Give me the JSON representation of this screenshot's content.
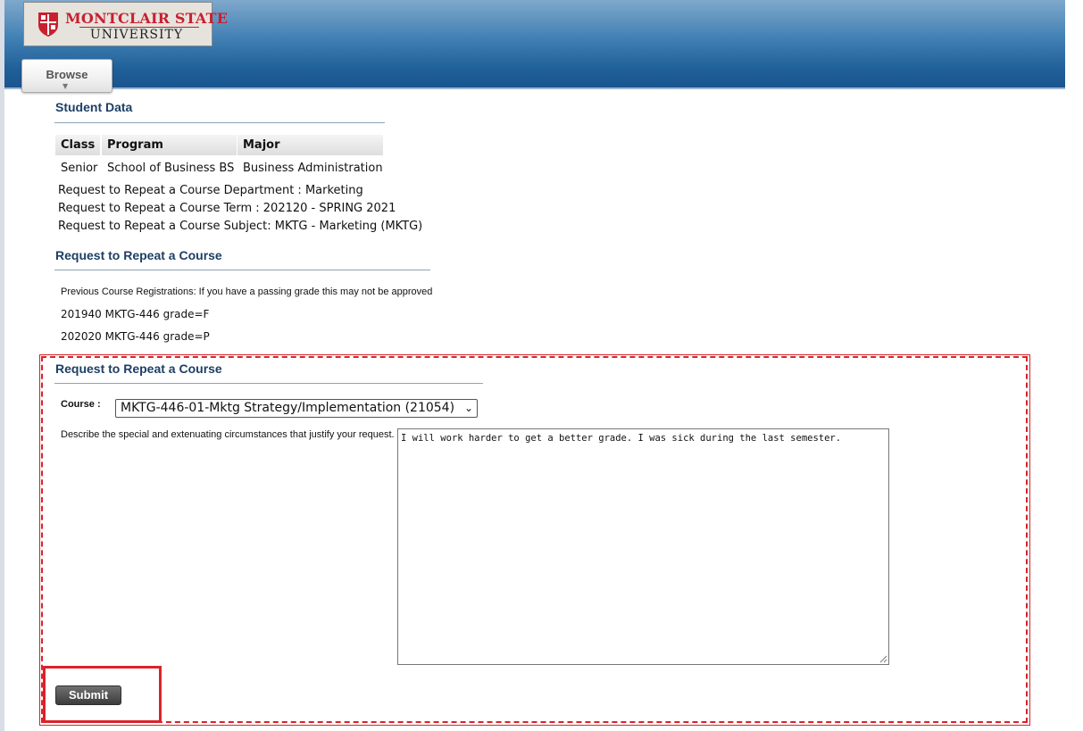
{
  "header": {
    "logo_line1": "MONTCLAIR STATE",
    "logo_line2": "UNIVERSITY",
    "browse_tab": "Browse"
  },
  "student_data": {
    "title": "Student Data",
    "columns": [
      "Class",
      "Program",
      "Major"
    ],
    "row": [
      "Senior",
      "School of Business BS",
      "Business Administration"
    ],
    "department_line": "Request to Repeat a Course Department : Marketing",
    "term_line": "Request to Repeat a Course Term : 202120 - SPRING 2021",
    "subject_line": "Request to Repeat a Course Subject: MKTG - Marketing (MKTG)"
  },
  "repeat_history": {
    "title": "Request to Repeat a Course",
    "note": "Previous Course Registrations: If you have a passing grade this may not be approved",
    "registrations": [
      "201940 MKTG-446 grade=F",
      "202020 MKTG-446 grade=P"
    ]
  },
  "repeat_form": {
    "title": "Request to Repeat a Course",
    "course_label": "Course :",
    "course_selected": "MKTG-446-01-Mktg Strategy/Implementation (21054)",
    "reason_label": "Describe the special and extenuating circumstances that justify your request.",
    "reason_value": "I will work harder to get a better grade. I was sick during the last semester.",
    "submit_label": "Submit"
  },
  "colors": {
    "header_blue": "#1f5f98",
    "title_navy": "#1d3f66",
    "highlight_red": "#d8232a",
    "logo_red": "#c8202f"
  },
  "icons": [
    "seal-icon",
    "caret-down-icon",
    "chevron-down-icon",
    "resize-grip-icon"
  ]
}
